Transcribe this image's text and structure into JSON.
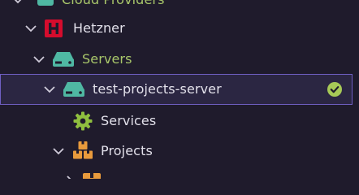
{
  "tree": {
    "items": [
      {
        "label": "Cloud Providers",
        "icon": "cloud-providers-icon",
        "expanded": true
      },
      {
        "label": "Hetzner",
        "icon": "hetzner-logo-icon",
        "expanded": true
      },
      {
        "label": "Servers",
        "icon": "server-icon",
        "expanded": true
      },
      {
        "label": "test-projects-server",
        "icon": "server-icon",
        "expanded": true,
        "selected": true,
        "status": "check-circle-icon"
      },
      {
        "label": "Services",
        "icon": "gear-icon",
        "expanded": false
      },
      {
        "label": "Projects",
        "icon": "boxes-icon",
        "expanded": true
      },
      {
        "label": "",
        "icon": "box-icon",
        "expanded": false
      }
    ]
  },
  "colors": {
    "background": "#1f1b2c",
    "selection": "#2b2642",
    "selection_border": "#6f5fc2",
    "text": "#e2e0ea",
    "green_text": "#a8c66a",
    "server_icon": "#4fb8a3",
    "hetzner_red": "#d50c2d",
    "gear": "#8fbf3f",
    "boxes": "#e89a3c",
    "check": "#a7c957"
  }
}
